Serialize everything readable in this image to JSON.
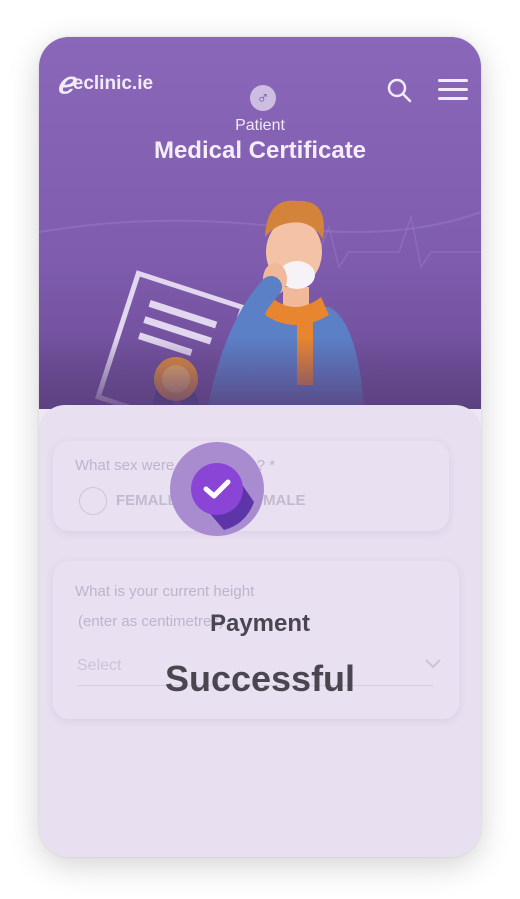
{
  "header": {
    "logo_text": "eclinic.ie",
    "sex_symbol": "♂",
    "role": "Patient",
    "title": "Medical Certificate",
    "icons": [
      "search-icon",
      "menu-icon"
    ]
  },
  "form": {
    "sex_question": "What sex were you born as? *",
    "sex_options": [
      "FEMALE",
      "MALE"
    ],
    "height_question_line1": "What is your current height",
    "height_question_line2": "(enter as centimetres)",
    "height_select_placeholder": "Select"
  },
  "overlay": {
    "line1": "Payment",
    "line2": "Successful"
  },
  "colors": {
    "brand_purple": "#7f5cae",
    "badge_purple": "#8a45d6",
    "text_dark": "#4a4650"
  }
}
